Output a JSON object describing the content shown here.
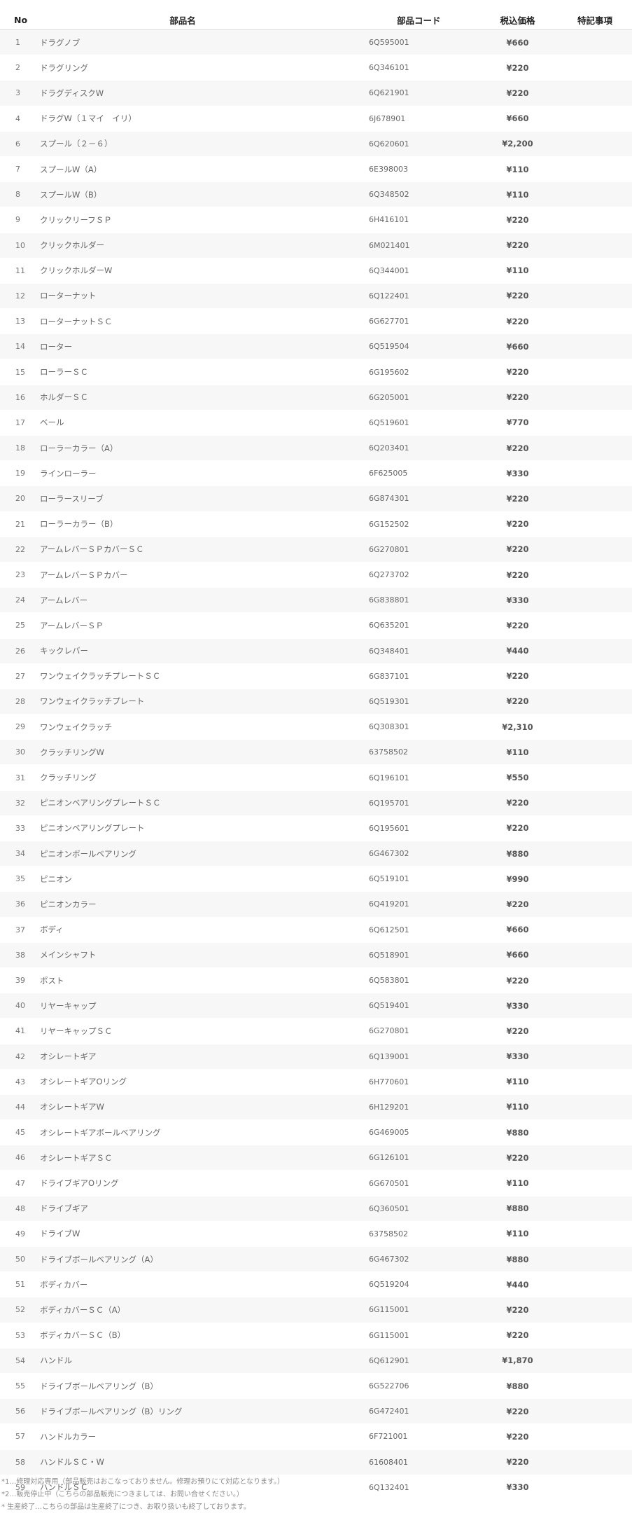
{
  "table": {
    "headers": {
      "no": "No",
      "name": "部品名",
      "code": "部品コード",
      "price": "税込価格",
      "note": "特記事項"
    },
    "rows": [
      {
        "no": "1",
        "name": "ドラグノブ",
        "code": "6Q595001",
        "price": "¥660",
        "note": ""
      },
      {
        "no": "2",
        "name": "ドラグリング",
        "code": "6Q346101",
        "price": "¥220",
        "note": ""
      },
      {
        "no": "3",
        "name": "ドラグディスクW",
        "code": "6Q621901",
        "price": "¥220",
        "note": ""
      },
      {
        "no": "4",
        "name": "ドラグW（１マイ　イリ）",
        "code": "6J678901",
        "price": "¥660",
        "note": ""
      },
      {
        "no": "6",
        "name": "スプール（２－６）",
        "code": "6Q620601",
        "price": "¥2,200",
        "note": ""
      },
      {
        "no": "7",
        "name": "スプールW（A）",
        "code": "6E398003",
        "price": "¥110",
        "note": ""
      },
      {
        "no": "8",
        "name": "スプールW（B）",
        "code": "6Q348502",
        "price": "¥110",
        "note": ""
      },
      {
        "no": "9",
        "name": "クリックリーフＳＰ",
        "code": "6H416101",
        "price": "¥220",
        "note": ""
      },
      {
        "no": "10",
        "name": "クリックホルダー",
        "code": "6M021401",
        "price": "¥220",
        "note": ""
      },
      {
        "no": "11",
        "name": "クリックホルダーW",
        "code": "6Q344001",
        "price": "¥110",
        "note": ""
      },
      {
        "no": "12",
        "name": "ローターナット",
        "code": "6Q122401",
        "price": "¥220",
        "note": ""
      },
      {
        "no": "13",
        "name": "ローターナットＳＣ",
        "code": "6G627701",
        "price": "¥220",
        "note": ""
      },
      {
        "no": "14",
        "name": "ローター",
        "code": "6Q519504",
        "price": "¥660",
        "note": ""
      },
      {
        "no": "15",
        "name": "ローラーＳＣ",
        "code": "6G195602",
        "price": "¥220",
        "note": ""
      },
      {
        "no": "16",
        "name": "ホルダーＳＣ",
        "code": "6G205001",
        "price": "¥220",
        "note": ""
      },
      {
        "no": "17",
        "name": "ベール",
        "code": "6Q519601",
        "price": "¥770",
        "note": ""
      },
      {
        "no": "18",
        "name": "ローラーカラー（A）",
        "code": "6Q203401",
        "price": "¥220",
        "note": ""
      },
      {
        "no": "19",
        "name": "ラインローラー",
        "code": "6F625005",
        "price": "¥330",
        "note": ""
      },
      {
        "no": "20",
        "name": "ローラースリーブ",
        "code": "6G874301",
        "price": "¥220",
        "note": ""
      },
      {
        "no": "21",
        "name": "ローラーカラー（B）",
        "code": "6G152502",
        "price": "¥220",
        "note": ""
      },
      {
        "no": "22",
        "name": "アームレバーＳＰカバーＳＣ",
        "code": "6G270801",
        "price": "¥220",
        "note": ""
      },
      {
        "no": "23",
        "name": "アームレバーＳＰカバー",
        "code": "6Q273702",
        "price": "¥220",
        "note": ""
      },
      {
        "no": "24",
        "name": "アームレバー",
        "code": "6G838801",
        "price": "¥330",
        "note": ""
      },
      {
        "no": "25",
        "name": "アームレバーＳＰ",
        "code": "6Q635201",
        "price": "¥220",
        "note": ""
      },
      {
        "no": "26",
        "name": "キックレバー",
        "code": "6Q348401",
        "price": "¥440",
        "note": ""
      },
      {
        "no": "27",
        "name": "ワンウェイクラッチプレートＳＣ",
        "code": "6G837101",
        "price": "¥220",
        "note": ""
      },
      {
        "no": "28",
        "name": "ワンウェイクラッチプレート",
        "code": "6Q519301",
        "price": "¥220",
        "note": ""
      },
      {
        "no": "29",
        "name": "ワンウェイクラッチ",
        "code": "6Q308301",
        "price": "¥2,310",
        "note": ""
      },
      {
        "no": "30",
        "name": "クラッチリングW",
        "code": "63758502",
        "price": "¥110",
        "note": ""
      },
      {
        "no": "31",
        "name": "クラッチリング",
        "code": "6Q196101",
        "price": "¥550",
        "note": ""
      },
      {
        "no": "32",
        "name": "ピニオンベアリングプレートＳＣ",
        "code": "6Q195701",
        "price": "¥220",
        "note": ""
      },
      {
        "no": "33",
        "name": "ピニオンベアリングプレート",
        "code": "6Q195601",
        "price": "¥220",
        "note": ""
      },
      {
        "no": "34",
        "name": "ピニオンボールベアリング",
        "code": "6G467302",
        "price": "¥880",
        "note": ""
      },
      {
        "no": "35",
        "name": "ピニオン",
        "code": "6Q519101",
        "price": "¥990",
        "note": ""
      },
      {
        "no": "36",
        "name": "ピニオンカラー",
        "code": "6Q419201",
        "price": "¥220",
        "note": ""
      },
      {
        "no": "37",
        "name": "ボディ",
        "code": "6Q612501",
        "price": "¥660",
        "note": ""
      },
      {
        "no": "38",
        "name": "メインシャフト",
        "code": "6Q518901",
        "price": "¥660",
        "note": ""
      },
      {
        "no": "39",
        "name": "ポスト",
        "code": "6Q583801",
        "price": "¥220",
        "note": ""
      },
      {
        "no": "40",
        "name": "リヤーキャップ",
        "code": "6Q519401",
        "price": "¥330",
        "note": ""
      },
      {
        "no": "41",
        "name": "リヤーキャップＳＣ",
        "code": "6G270801",
        "price": "¥220",
        "note": ""
      },
      {
        "no": "42",
        "name": "オシレートギア",
        "code": "6Q139001",
        "price": "¥330",
        "note": ""
      },
      {
        "no": "43",
        "name": "オシレートギアOリング",
        "code": "6H770601",
        "price": "¥110",
        "note": ""
      },
      {
        "no": "44",
        "name": "オシレートギアW",
        "code": "6H129201",
        "price": "¥110",
        "note": ""
      },
      {
        "no": "45",
        "name": "オシレートギアボールベアリング",
        "code": "6G469005",
        "price": "¥880",
        "note": ""
      },
      {
        "no": "46",
        "name": "オシレートギアＳＣ",
        "code": "6G126101",
        "price": "¥220",
        "note": ""
      },
      {
        "no": "47",
        "name": "ドライブギアOリング",
        "code": "6G670501",
        "price": "¥110",
        "note": ""
      },
      {
        "no": "48",
        "name": "ドライブギア",
        "code": "6Q360501",
        "price": "¥880",
        "note": ""
      },
      {
        "no": "49",
        "name": "ドライブW",
        "code": "63758502",
        "price": "¥110",
        "note": ""
      },
      {
        "no": "50",
        "name": "ドライブボールベアリング（A）",
        "code": "6G467302",
        "price": "¥880",
        "note": ""
      },
      {
        "no": "51",
        "name": "ボディカバー",
        "code": "6Q519204",
        "price": "¥440",
        "note": ""
      },
      {
        "no": "52",
        "name": "ボディカバーＳＣ（A）",
        "code": "6G115001",
        "price": "¥220",
        "note": ""
      },
      {
        "no": "53",
        "name": "ボディカバーＳＣ（B）",
        "code": "6G115001",
        "price": "¥220",
        "note": ""
      },
      {
        "no": "54",
        "name": "ハンドル",
        "code": "6Q612901",
        "price": "¥1,870",
        "note": ""
      },
      {
        "no": "55",
        "name": "ドライブボールベアリング（B）",
        "code": "6G522706",
        "price": "¥880",
        "note": ""
      },
      {
        "no": "56",
        "name": "ドライブボールベアリング（B）リング",
        "code": "6G472401",
        "price": "¥220",
        "note": ""
      },
      {
        "no": "57",
        "name": "ハンドルカラー",
        "code": "6F721001",
        "price": "¥220",
        "note": ""
      },
      {
        "no": "58",
        "name": "ハンドルＳＣ・W",
        "code": "61608401",
        "price": "¥220",
        "note": ""
      },
      {
        "no": "59",
        "name": "ハンドルＳＣ",
        "code": "6Q132401",
        "price": "¥330",
        "note": ""
      }
    ]
  },
  "notes": [
    "*1…修理対応専用（部品販売はおこなっておりません。修理お預りにて対応となります。）",
    "*2…販売停止中（こちらの部品販売につきましては、お問い合せください。）",
    "* 生産終了…こちらの部品は生産終了につき、お取り扱いも終了しております。"
  ]
}
